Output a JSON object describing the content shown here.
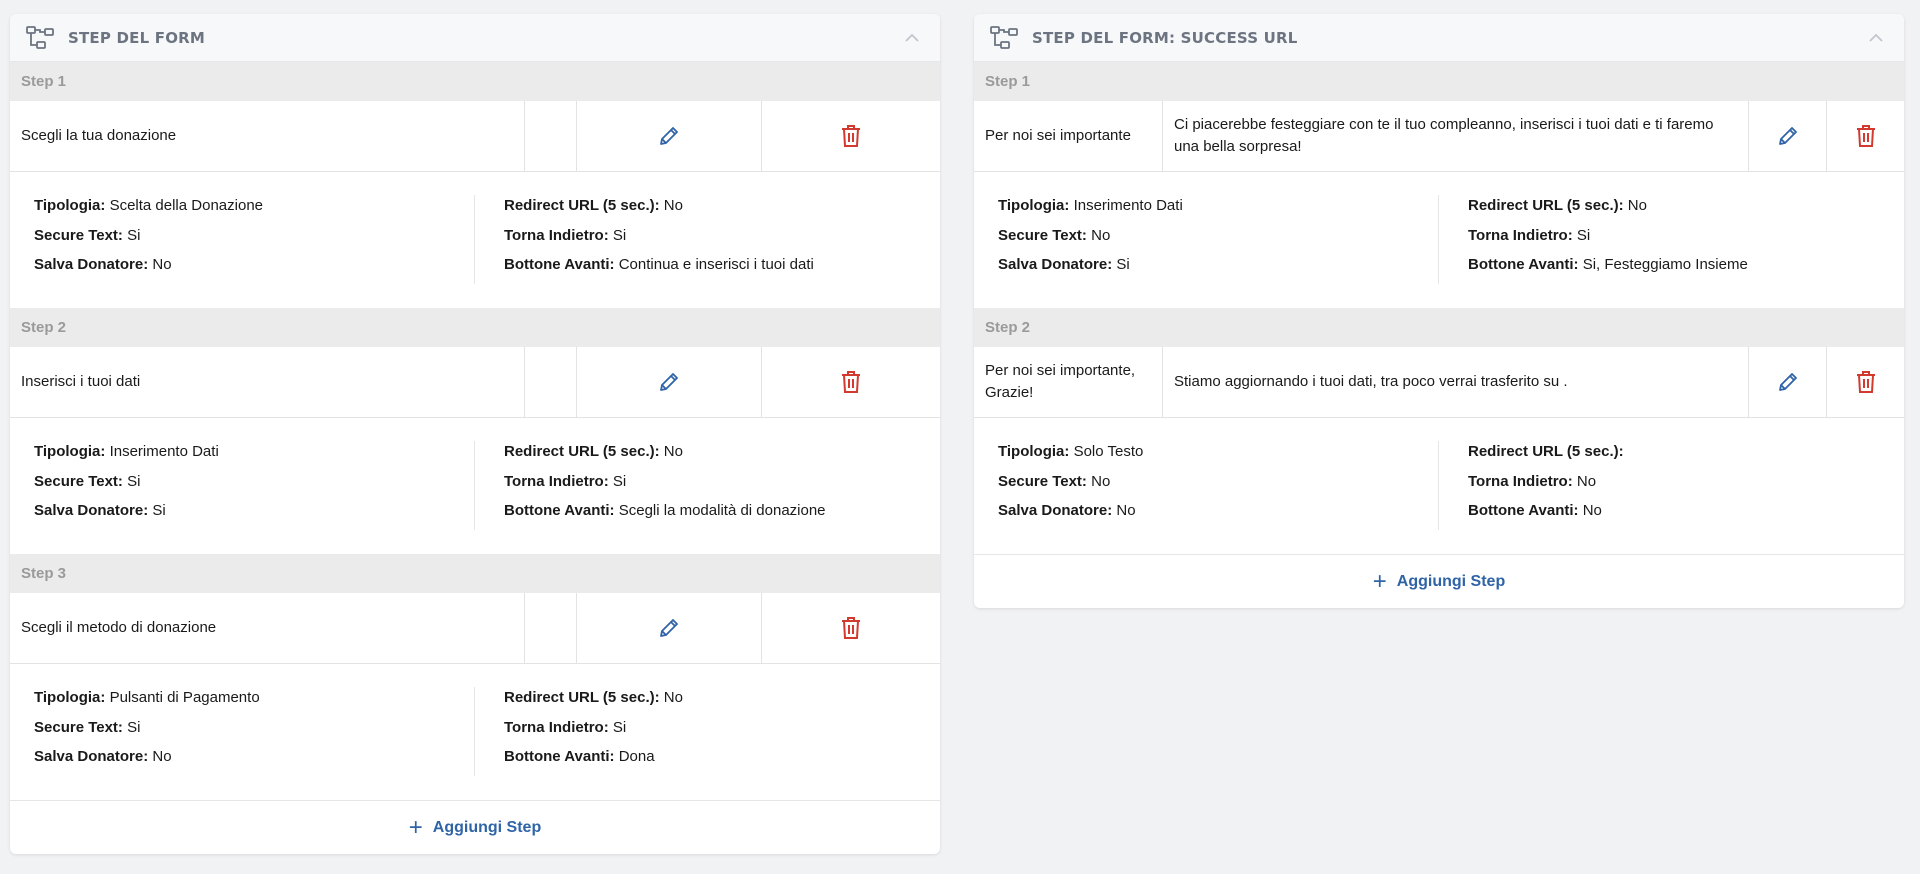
{
  "colors": {
    "edit": "#2f64a7",
    "delete": "#d23a2f",
    "label": "#9a9a9a"
  },
  "left": {
    "title": "STEP DEL FORM",
    "steps": [
      {
        "label": "Step 1",
        "name": "Scegli la tua donazione",
        "tipologia": "Scelta della Donazione",
        "secure_text": "Si",
        "salva_donatore": "No",
        "redirect_url": "No",
        "torna_indietro": "Si",
        "bottone_avanti": "Continua e inserisci i tuoi dati"
      },
      {
        "label": "Step 2",
        "name": "Inserisci i tuoi dati",
        "tipologia": "Inserimento Dati",
        "secure_text": "Si",
        "salva_donatore": "Si",
        "redirect_url": "No",
        "torna_indietro": "Si",
        "bottone_avanti": "Scegli la modalità di donazione"
      },
      {
        "label": "Step 3",
        "name": "Scegli il metodo di donazione",
        "tipologia": "Pulsanti di Pagamento",
        "secure_text": "Si",
        "salva_donatore": "No",
        "redirect_url": "No",
        "torna_indietro": "Si",
        "bottone_avanti": "Dona"
      }
    ],
    "add_label": "Aggiungi Step"
  },
  "right": {
    "title": "STEP DEL FORM: SUCCESS URL",
    "steps": [
      {
        "label": "Step 1",
        "name": "Per noi sei importante",
        "description": "Ci piacerebbe festeggiare con te il tuo compleanno, inserisci i tuoi dati e ti faremo una bella sorpresa!",
        "tipologia": "Inserimento Dati",
        "secure_text": "No",
        "salva_donatore": "Si",
        "redirect_url": "No",
        "torna_indietro": "Si",
        "bottone_avanti": "Si, Festeggiamo Insieme"
      },
      {
        "label": "Step 2",
        "name": "Per noi sei importante, Grazie!",
        "description": "Stiamo aggiornando i tuoi dati, tra poco verrai trasferito su .",
        "tipologia": "Solo Testo",
        "secure_text": "No",
        "salva_donatore": "No",
        "redirect_url": "",
        "torna_indietro": "No",
        "bottone_avanti": "No"
      }
    ],
    "add_label": "Aggiungi Step"
  },
  "field_labels": {
    "tipologia": "Tipologia:",
    "secure_text": "Secure Text:",
    "salva_donatore": "Salva Donatore:",
    "redirect_url": "Redirect URL (5 sec.):",
    "torna_indietro": "Torna Indietro:",
    "bottone_avanti": "Bottone Avanti:"
  }
}
